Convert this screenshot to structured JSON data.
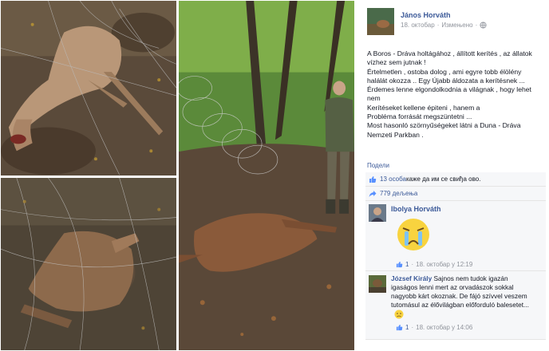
{
  "post": {
    "author": "János Horváth",
    "date": "18. октобар",
    "edited": "Измењено",
    "lines": [
      "A Boros - Dráva holtágához , állított kerítés , az állatok",
      "vízhez sem jutnak !",
      "Értelmetlen , ostoba dolog , ami egyre tobb élölény",
      "halálát okozza .. Egy Újabb áldozata a kerítésnek ...",
      "Érdemes lenne elgondolkodnia a világnak , hogy lehet",
      "nem",
      "Kerítéseket kellene épiteni , hanem a",
      "Probléma forrását megszüntetni ...",
      "Most hasonló szörnyűségeket látni a Duna - Dráva",
      "Nemzeti Parkban ."
    ],
    "share_link": "Подели"
  },
  "ufi": {
    "likes_count": "13 особа",
    "likes_text": " каже да им се свиђа ово.",
    "shares": "779 дељења"
  },
  "comments": [
    {
      "name": "Ibolya Horváth",
      "text": "",
      "likes": "1",
      "date": "18. октобар у 12:19"
    },
    {
      "name": "József Király",
      "text_lines": [
        " Sajnos nem tudok igazán",
        "igaságos lenni mert az orvadászok sokkal",
        "nagyobb kárt okoznak. De fájó szívvel veszem",
        "tutomásul az élővilágban előforduló balesetet..."
      ],
      "likes": "1",
      "date": "18. октобар у 14:06"
    }
  ],
  "colors": {
    "link": "#3b5998",
    "meta": "#90949c",
    "ufi_bg": "#f6f7f9"
  }
}
